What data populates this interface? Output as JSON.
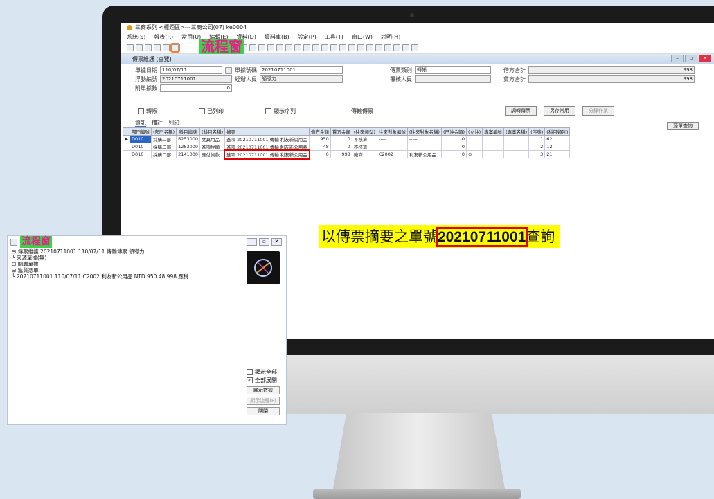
{
  "app": {
    "title": "三商系列 <標題區>---三商公司(07) ke0004",
    "menu": [
      "系統(S)",
      "報表(R)",
      "常用(U)",
      "編輯(E)",
      "資料(D)",
      "資料庫(B)",
      "設定(P)",
      "工具(T)",
      "窗口(W)",
      "說明(H)"
    ],
    "toolbar_label": "流程窗"
  },
  "document": {
    "title": "傳票維護 (查覽)",
    "fields": {
      "date_label": "單據日期",
      "date_value": "110/07/11",
      "doc_no_label": "單據號碼",
      "doc_no_value": "20210711001",
      "voucher_type_label": "傳票類別",
      "voucher_type_value": "轉帳",
      "debit_total_label": "借方合計",
      "debit_total_value": "998",
      "float_no_label": "浮動編號",
      "float_no_value": "20210711001",
      "handler_label": "經辦人員",
      "handler_value": "領導力",
      "reviewer_label": "覆核人員",
      "reviewer_value": "",
      "credit_total_label": "貸方合計",
      "credit_total_value": "998",
      "attach_label": "附單據數",
      "attach_value": "0"
    },
    "checkboxes": [
      "轉帳",
      "已列印",
      "顯示序列"
    ],
    "center_label": "傳輸傳票",
    "buttons": {
      "voucher_query": "源單查詢",
      "adjust": "調轉傳票",
      "save_as": "另存常用",
      "other": "分錄作業"
    },
    "tabs": [
      "資訊",
      "備註",
      "列印"
    ],
    "grid": {
      "headers": [
        "部門編號",
        "(部門名稱)",
        "科目編號",
        "(科目名稱)",
        "摘要",
        "借方金額",
        "貸方金額",
        "(往來類型)",
        "往來對象編號",
        "(往來對象名稱)",
        "(已沖金額)",
        "(立沖)",
        "專案編號",
        "(專案名稱)",
        "(序號)",
        "(科目類別)"
      ],
      "rows": [
        [
          "D010",
          "採購二部",
          "6253000",
          "文具用品",
          "進項 20210711001 傳輸 利友新公用品",
          "950",
          "0",
          "不核算",
          "-----",
          "-----",
          "0",
          "",
          "",
          "",
          "1",
          "62"
        ],
        [
          "D010",
          "採購二部",
          "1283000",
          "進項稅額",
          "進項 20210711001 傳輸 利友新公用品",
          "48",
          "0",
          "不核算",
          "-----",
          "-----",
          "0",
          "",
          "",
          "",
          "2",
          "12"
        ],
        [
          "D010",
          "採購二部",
          "2141000",
          "應付帳款",
          "進項 20210711001 傳輸 利友新公用品",
          "0",
          "998",
          "廠商",
          "C2002",
          "利友新公用品",
          "0",
          "⊙",
          "",
          "",
          "3",
          "21"
        ]
      ]
    }
  },
  "caption": {
    "prefix": "以傳票摘要之單號",
    "number": "20210711001",
    "suffix": "查詢"
  },
  "flow_window": {
    "title": "流程窗",
    "tree": [
      "⊟ 傳票維護  20210711001  110/07/11  傳輸傳票    領導力",
      "    └ 來源單據(無)",
      "    ⊟ 關聯單據",
      "        ⊟ 進貨憑單",
      "            └ 20210711001  110/07/11  C2002  利友新公用品  NTD  950  48  998  應稅"
    ],
    "options": {
      "show_all": "顯示全部",
      "expand_all": "全部展開"
    },
    "buttons": {
      "show_data": "顯示數據",
      "show_flow": "顯示流程(F)",
      "close": "關閉"
    }
  }
}
